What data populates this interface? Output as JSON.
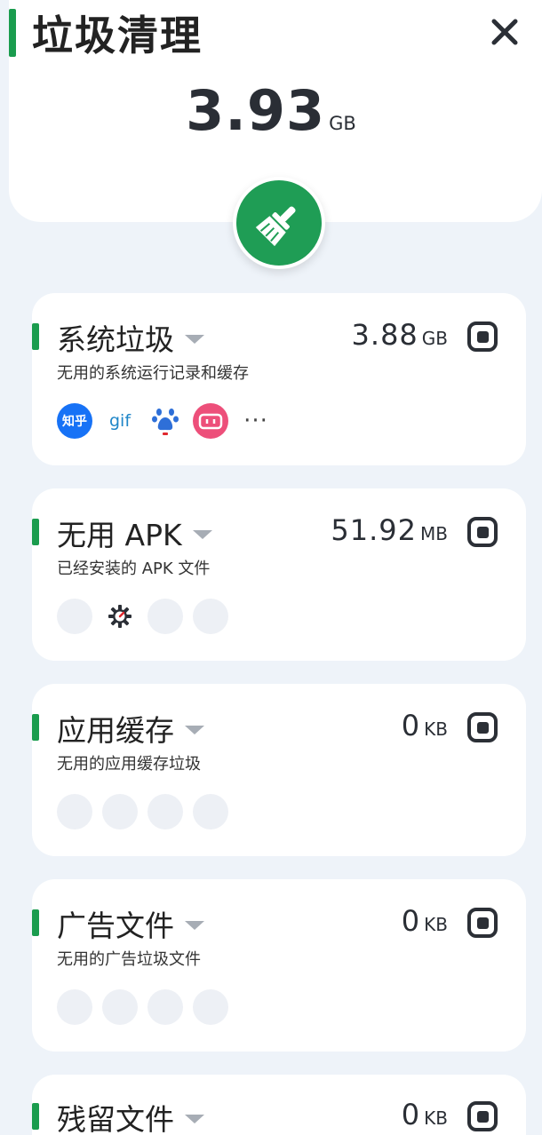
{
  "header": {
    "title": "垃圾清理",
    "total_value": "3.93",
    "total_unit": "GB"
  },
  "colors": {
    "accent": "#1a9c4e",
    "clean_button": "#1f9d55"
  },
  "icons": {
    "close": "close-icon",
    "clean": "broom-icon",
    "checkbox": "checkbox-icon"
  },
  "categories": [
    {
      "title": "系统垃圾",
      "description": "无用的系统运行记录和缓存",
      "size_value": "3.88",
      "size_unit": "GB",
      "apps": [
        {
          "label": "知乎",
          "icon": "zhihu-icon"
        },
        {
          "label": "gif",
          "icon": "gif-icon"
        },
        {
          "icon": "baidu-icon"
        },
        {
          "icon": "bilibili-icon"
        }
      ],
      "more_label": "···"
    },
    {
      "title": "无用 APK",
      "description": "已经安装的 APK 文件",
      "size_value": "51.92",
      "size_unit": "MB",
      "apps": [
        {
          "icon": "placeholder-icon"
        },
        {
          "icon": "gear-icon"
        },
        {
          "icon": "placeholder-icon"
        },
        {
          "icon": "placeholder-icon"
        }
      ]
    },
    {
      "title": "应用缓存",
      "description": "无用的应用缓存垃圾",
      "size_value": "0",
      "size_unit": "KB"
    },
    {
      "title": "广告文件",
      "description": "无用的广告垃圾文件",
      "size_value": "0",
      "size_unit": "KB"
    },
    {
      "title": "残留文件",
      "size_value": "0",
      "size_unit": "KB"
    }
  ]
}
